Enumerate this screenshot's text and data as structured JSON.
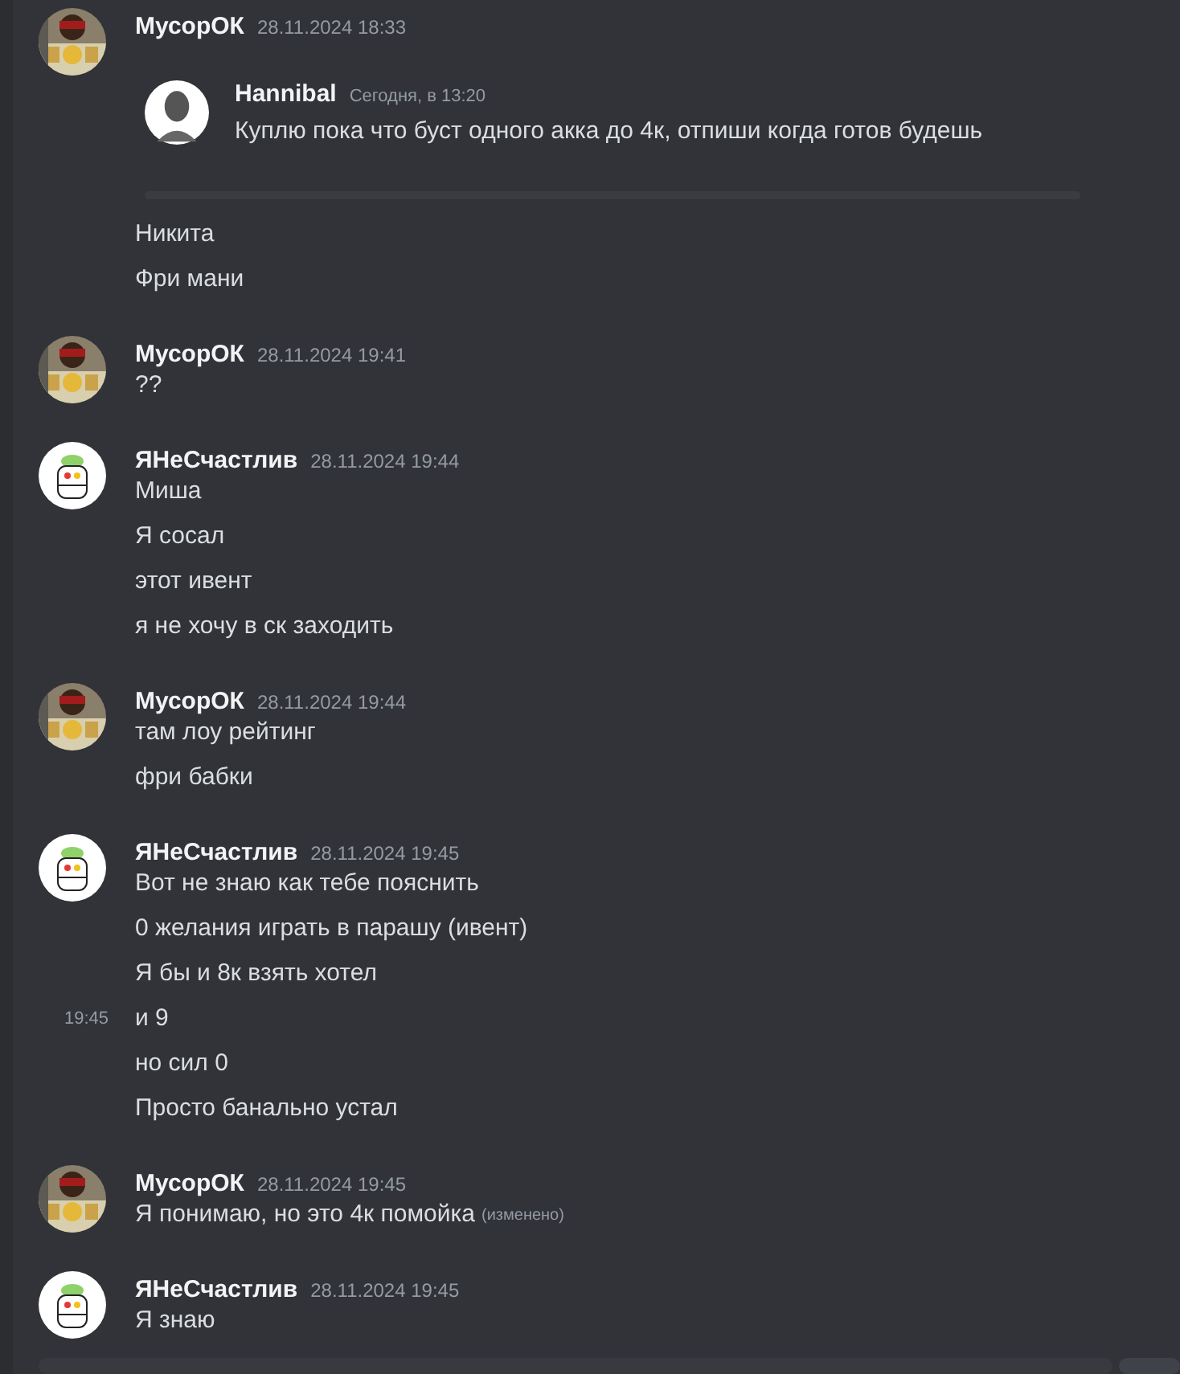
{
  "messages": [
    {
      "author": "МусорОК",
      "timestamp": "28.11.2024 18:33",
      "avatar": {
        "kind": "photo"
      },
      "forward": {
        "author": "Hannibal",
        "timestamp": "Сегодня, в 13:20",
        "text": "Куплю пока что буст одного акка до 4к, отпиши когда готов будешь"
      },
      "lines": [
        {
          "text": "Никита"
        },
        {
          "text": "Фри мани"
        }
      ]
    },
    {
      "author": "МусорОК",
      "timestamp": "28.11.2024 19:41",
      "avatar": {
        "kind": "photo"
      },
      "lines": [
        {
          "text": "??"
        }
      ]
    },
    {
      "author": "ЯНеСчастлив",
      "timestamp": "28.11.2024 19:44",
      "avatar": {
        "kind": "cartoon"
      },
      "lines": [
        {
          "text": "Миша"
        },
        {
          "text": "Я сосал"
        },
        {
          "text": "этот ивент"
        },
        {
          "text": "я не хочу в ск заходить"
        }
      ]
    },
    {
      "author": "МусорОК",
      "timestamp": "28.11.2024 19:44",
      "avatar": {
        "kind": "photo"
      },
      "lines": [
        {
          "text": "там лоу рейтинг"
        },
        {
          "text": "фри бабки"
        }
      ]
    },
    {
      "author": "ЯНеСчастлив",
      "timestamp": "28.11.2024 19:45",
      "avatar": {
        "kind": "cartoon"
      },
      "lines": [
        {
          "text": "Вот не знаю как тебе пояснить"
        },
        {
          "text": "0 желания играть в парашу (ивент)"
        },
        {
          "text": "Я бы и 8к взять хотел"
        },
        {
          "text": "и 9",
          "hover_time": "19:45"
        },
        {
          "text": "но сил 0"
        },
        {
          "text": "Просто банально устал"
        }
      ]
    },
    {
      "author": "МусорОК",
      "timestamp": "28.11.2024 19:45",
      "avatar": {
        "kind": "photo"
      },
      "lines": [
        {
          "text": "Я понимаю, но это 4к помойка",
          "edited": "(изменено)"
        }
      ]
    },
    {
      "author": "ЯНеСчастлив",
      "timestamp": "28.11.2024 19:45",
      "avatar": {
        "kind": "cartoon"
      },
      "lines": [
        {
          "text": "Я знаю"
        }
      ]
    }
  ]
}
